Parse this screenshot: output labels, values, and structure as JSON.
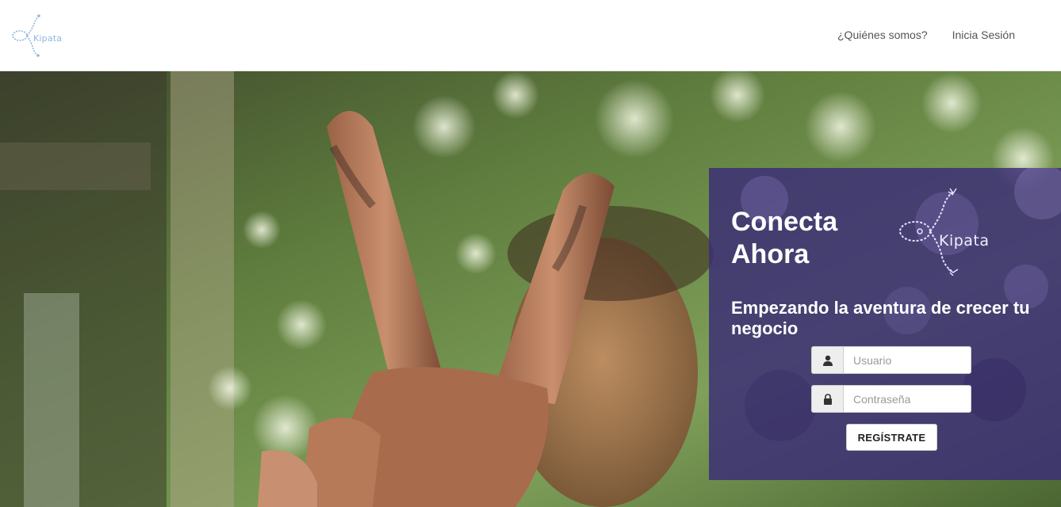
{
  "header": {
    "brand": {
      "name": "Kipata",
      "icon": "kipata-logo-icon"
    },
    "nav": [
      {
        "label": "¿Quiénes somos?"
      },
      {
        "label": "Inicia Sesión"
      }
    ]
  },
  "login": {
    "title_line1": "Conecta",
    "title_line2": "Ahora",
    "logo_text": "Kipata",
    "subtitle": "Empezando la aventura de crecer tu negocio",
    "username": {
      "placeholder": "Usuario",
      "value": "",
      "icon": "user-icon"
    },
    "password": {
      "placeholder": "Contraseña",
      "value": "",
      "icon": "lock-icon"
    },
    "register_label": "REGÍSTRATE"
  },
  "colors": {
    "panel": "#3a2c78",
    "nav_text": "#555555",
    "brand_accent": "#8fb7dc"
  }
}
